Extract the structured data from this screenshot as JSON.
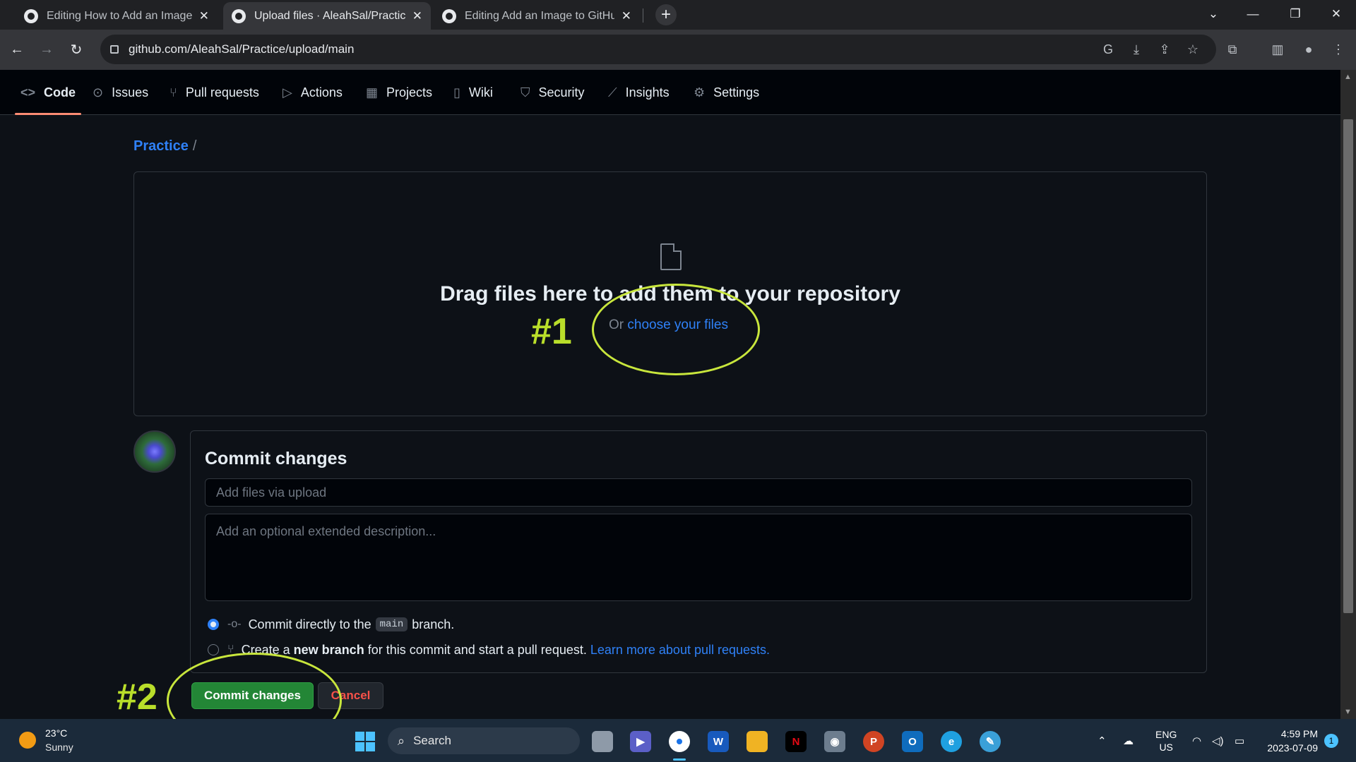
{
  "browser": {
    "tabs": [
      {
        "title": "Editing How to Add an Image to",
        "active": false
      },
      {
        "title": "Upload files · AleahSal/Practice",
        "active": true
      },
      {
        "title": "Editing Add an Image to GitHub",
        "active": false
      }
    ],
    "new_tab": "+",
    "url": "github.com/AleahSal/Practice/upload/main"
  },
  "repo_nav": {
    "items": [
      {
        "label": "Code",
        "icon": "code-icon"
      },
      {
        "label": "Issues",
        "icon": "issue-icon"
      },
      {
        "label": "Pull requests",
        "icon": "pull-request-icon"
      },
      {
        "label": "Actions",
        "icon": "play-icon"
      },
      {
        "label": "Projects",
        "icon": "table-icon"
      },
      {
        "label": "Wiki",
        "icon": "book-icon"
      },
      {
        "label": "Security",
        "icon": "shield-icon"
      },
      {
        "label": "Insights",
        "icon": "graph-icon"
      },
      {
        "label": "Settings",
        "icon": "gear-icon"
      }
    ],
    "selected": "Code"
  },
  "breadcrumb": {
    "repo": "Practice",
    "separator": "/"
  },
  "dropzone": {
    "title": "Drag files here to add them to your repository",
    "or_text": "Or",
    "choose_link": "choose your files"
  },
  "commit": {
    "heading": "Commit changes",
    "summary_placeholder": "Add files via upload",
    "description_placeholder": "Add an optional extended description...",
    "option_direct": {
      "prefix": "Commit directly to the",
      "branch": "main",
      "suffix": "branch."
    },
    "option_new": {
      "prefix": "Create a",
      "bold": "new branch",
      "suffix": "for this commit and start a pull request.",
      "link": "Learn more about pull requests."
    },
    "commit_button": "Commit changes",
    "cancel_button": "Cancel"
  },
  "annotations": {
    "first": "#1",
    "second": "#2",
    "color": "#c8e63c"
  },
  "taskbar": {
    "weather_temp": "23°C",
    "weather_desc": "Sunny",
    "search": "Search",
    "lang_top": "ENG",
    "lang_bottom": "US",
    "time": "4:59 PM",
    "date": "2023-07-09",
    "notifications": "1"
  },
  "colors": {
    "link": "#2f81f7",
    "primary_button": "#238636",
    "danger": "#f85149",
    "selected_underline": "#fd8c73"
  }
}
